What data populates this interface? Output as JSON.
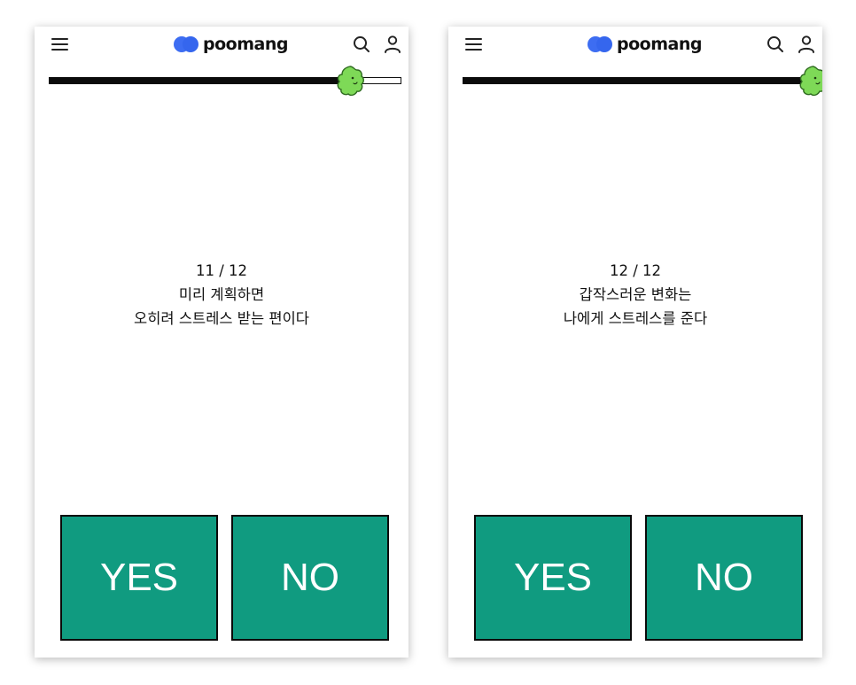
{
  "brand": {
    "name": "poomang",
    "mark_color": "#3d6df2"
  },
  "colors": {
    "button": "#109b80",
    "progress": "#0b0b0b",
    "blob": "#7ed957"
  },
  "icons": {
    "menu": "hamburger-menu-icon",
    "search": "search-icon",
    "account": "user-icon",
    "progress_marker": "green-blob-character-icon"
  },
  "screens": [
    {
      "progress": 11,
      "total": 12,
      "counter": "11 / 12",
      "question_lines": [
        "미리 계획하면",
        "오히려 스트레스 받는 편이다"
      ],
      "yes_label": "YES",
      "no_label": "NO"
    },
    {
      "progress": 12,
      "total": 12,
      "counter": "12 / 12",
      "question_lines": [
        "갑작스러운 변화는",
        "나에게 스트레스를 준다"
      ],
      "yes_label": "YES",
      "no_label": "NO"
    }
  ]
}
